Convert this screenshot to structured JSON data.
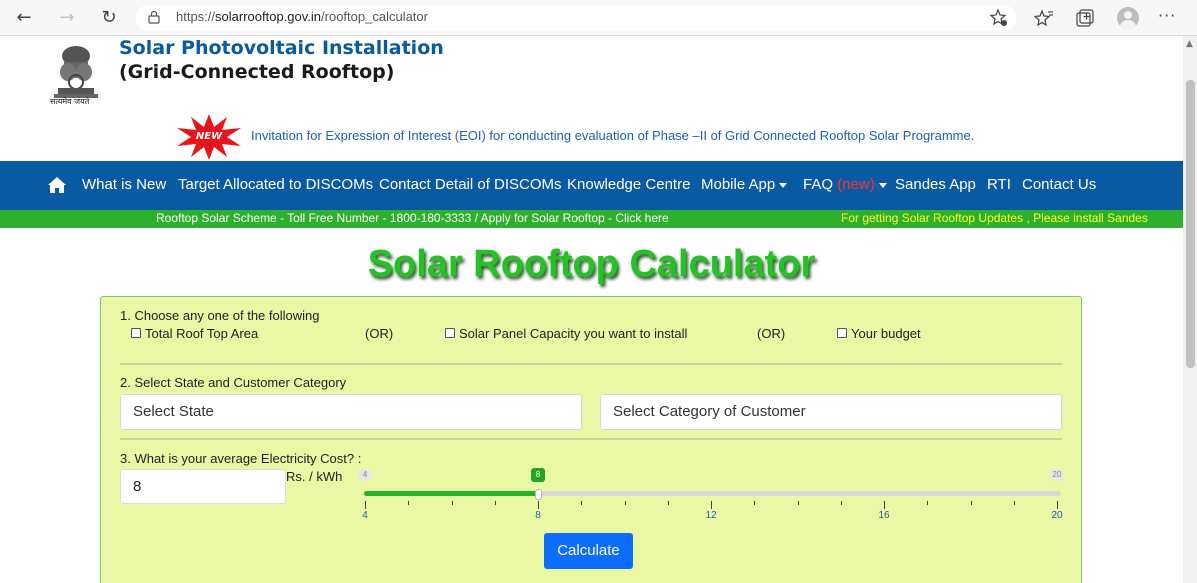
{
  "browser": {
    "url_scheme": "https://",
    "url_host": "solarrooftop.gov.in",
    "url_path": "/rooftop_calculator"
  },
  "header": {
    "title_line1": "Solar Photovoltaic Installation",
    "title_line2": "(Grid-Connected Rooftop)",
    "emblem_caption": "सत्यमेव जयते"
  },
  "announcement": {
    "badge": "NEW",
    "text": "Invitation for Expression of Interest (EOI) for conducting evaluation of Phase –II of Grid Connected Rooftop Solar Programme."
  },
  "nav": {
    "items": [
      {
        "label": "What is New"
      },
      {
        "label": "Target Allocated to DISCOMs"
      },
      {
        "label": "Contact Detail of DISCOMs"
      },
      {
        "label": "Knowledge Centre"
      },
      {
        "label": "Mobile App"
      },
      {
        "label": "FAQ",
        "tag": "(new)"
      },
      {
        "label": "Sandes App"
      },
      {
        "label": "RTI"
      },
      {
        "label": "Contact Us"
      }
    ]
  },
  "ticker": {
    "text1": "Rooftop Solar Scheme - Toll Free Number - 1800-180-3333 / Apply for Solar Rooftop - Click here",
    "text2": "For getting Solar Rooftop Updates , Please install Sandes"
  },
  "calculator": {
    "heading": "Solar Rooftop Calculator",
    "step1": {
      "label": "1. Choose any one of the following",
      "option1": "Total Roof Top Area",
      "or1": "(OR)",
      "option2": "Solar Panel Capacity you want to install",
      "or2": "(OR)",
      "option3": "Your budget"
    },
    "step2": {
      "label": "2. Select State and Customer Category",
      "state_placeholder": "Select State",
      "category_placeholder": "Select Category of Customer"
    },
    "step3": {
      "label": "3. What is your average Electricity Cost? :",
      "value": "8",
      "unit": "Rs. / kWh",
      "slider_min": 4,
      "slider_max": 20,
      "slider_value": 8,
      "slider_min_label": "4",
      "slider_max_label": "20",
      "slider_value_label": "8",
      "tick_labels": [
        "4",
        "8",
        "12",
        "16",
        "20"
      ]
    },
    "calculate_label": "Calculate"
  },
  "colors": {
    "nav_blue": "#0a5aa3",
    "ticker_green": "#2db02d",
    "panel_bg": "#eaf7a4",
    "heading_green": "#22c322",
    "button_blue": "#0d6efd"
  }
}
